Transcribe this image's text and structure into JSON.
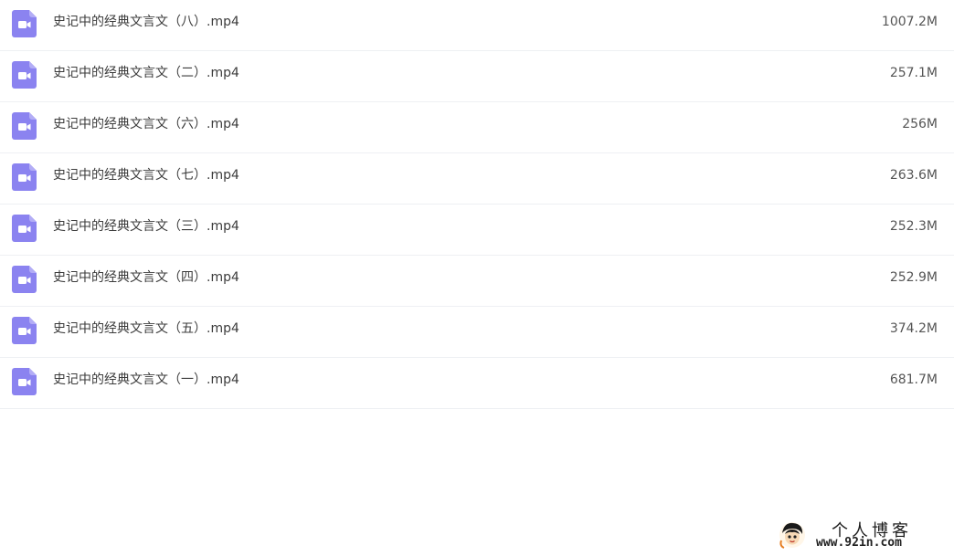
{
  "colors": {
    "icon_accent": "#8b83f0",
    "divider": "#eef0f3",
    "name_text": "#3c3c3c",
    "size_text": "#555555"
  },
  "files": [
    {
      "name": "史记中的经典文言文（八）.mp4",
      "size": "1007.2M",
      "icon": "video-file-icon"
    },
    {
      "name": "史记中的经典文言文（二）.mp4",
      "size": "257.1M",
      "icon": "video-file-icon"
    },
    {
      "name": "史记中的经典文言文（六）.mp4",
      "size": "256M",
      "icon": "video-file-icon"
    },
    {
      "name": "史记中的经典文言文（七）.mp4",
      "size": "263.6M",
      "icon": "video-file-icon"
    },
    {
      "name": "史记中的经典文言文（三）.mp4",
      "size": "252.3M",
      "icon": "video-file-icon"
    },
    {
      "name": "史记中的经典文言文（四）.mp4",
      "size": "252.9M",
      "icon": "video-file-icon"
    },
    {
      "name": "史记中的经典文言文（五）.mp4",
      "size": "374.2M",
      "icon": "video-file-icon"
    },
    {
      "name": "史记中的经典文言文（一）.mp4",
      "size": "681.7M",
      "icon": "video-file-icon"
    }
  ],
  "watermark": {
    "title": "个人博客",
    "url": "www.92in.com"
  }
}
